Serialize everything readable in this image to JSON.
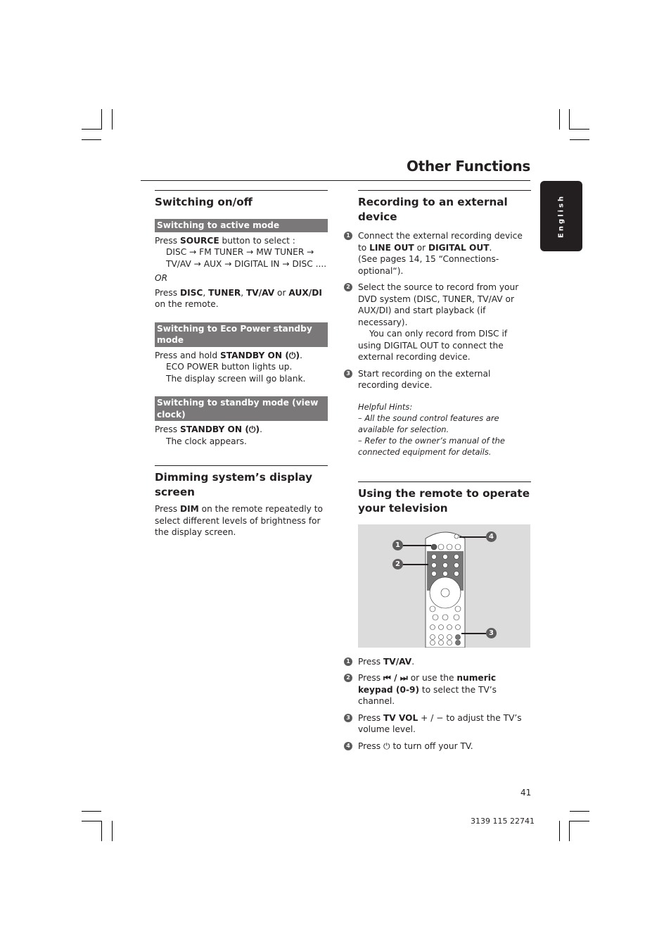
{
  "page": {
    "title": "Other Functions",
    "language_tab": "English",
    "page_number": "41",
    "doc_number": "3139 115 22741"
  },
  "left": {
    "switching": {
      "heading": "Switching on/off",
      "active": {
        "subheading": "Switching to active mode",
        "line1_pre": "Press ",
        "line1_bold": "SOURCE",
        "line1_post": " button to select :",
        "sequence": "DISC → FM TUNER → MW TUNER → TV/AV → AUX → DIGITAL IN → DISC ....",
        "or": "OR",
        "line2_pre": "Press ",
        "line2_b1": "DISC",
        "line2_s1": ", ",
        "line2_b2": "TUNER",
        "line2_s2": ", ",
        "line2_b3": "TV/AV",
        "line2_s3": " or ",
        "line2_b4": "AUX/DI",
        "line2_post": " on the remote."
      },
      "eco": {
        "subheading": "Switching to Eco Power standby mode",
        "line_pre": "Press and hold ",
        "line_bold": "STANDBY ON (⏻)",
        "line_post": ".",
        "result1": "ECO POWER button lights up.",
        "result2": "The display screen will go blank."
      },
      "standby": {
        "subheading": "Switching to standby mode (view clock)",
        "line_pre": "Press ",
        "line_bold": "STANDBY ON (⏻)",
        "line_post": ".",
        "result1": "The clock appears."
      }
    },
    "dimming": {
      "heading": "Dimming system’s display screen",
      "pre": "Press ",
      "bold": "DIM",
      "post": " on the remote repeatedly to select different levels of brightness for the display screen."
    }
  },
  "right": {
    "recording": {
      "heading": "Recording to an external device",
      "steps": [
        {
          "num": "1",
          "pre": "Connect the external recording device to ",
          "b1": "LINE OUT",
          "mid": " or ",
          "b2": "DIGITAL OUT",
          "post": ".",
          "note": "(See pages 14, 15 “Connections-optional“)."
        },
        {
          "num": "2",
          "text": "Select the source to record from your DVD system (DISC, TUNER, TV/AV or AUX/DI) and start playback (if necessary).",
          "note": "You can only record from DISC if using DIGITAL OUT to connect the external recording device."
        },
        {
          "num": "3",
          "text": "Start recording on the external recording device."
        }
      ],
      "hints_title": "Helpful Hints:",
      "hints": [
        "– All the sound control features are available for selection.",
        "– Refer to the owner’s manual of the connected equipment for details."
      ]
    },
    "tv": {
      "heading": "Using the remote to operate your television",
      "callouts": [
        "1",
        "2",
        "3",
        "4"
      ],
      "steps": [
        {
          "num": "1",
          "pre": "Press ",
          "bold": "TV/AV",
          "post": "."
        },
        {
          "num": "2",
          "pre": "Press ",
          "sym": "⏮ / ⏭",
          "mid": " or use the ",
          "bold": "numeric keypad (0-9)",
          "post": " to select the TV’s channel."
        },
        {
          "num": "3",
          "pre": "Press ",
          "bold": "TV VOL",
          "sym": " + / − ",
          "post": " to adjust the TV’s volume level."
        },
        {
          "num": "4",
          "pre": "Press ",
          "sym": "⏻",
          "post": " to turn off your TV."
        }
      ]
    }
  }
}
